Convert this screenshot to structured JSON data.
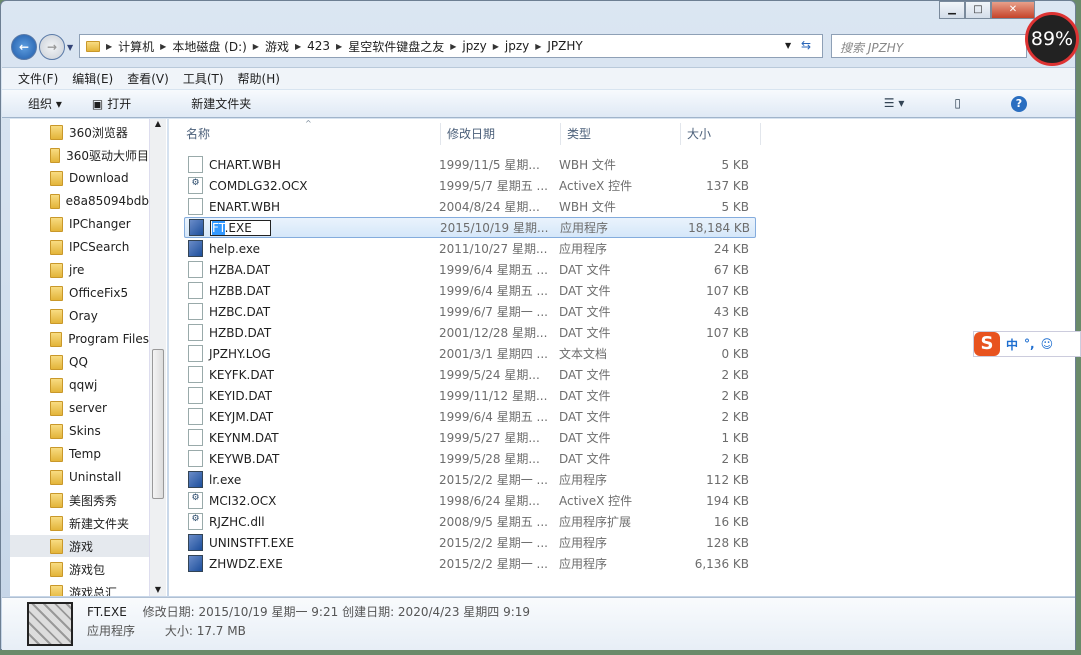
{
  "window": {
    "gauge": "89%",
    "controls": [
      "minimize",
      "maximize",
      "close"
    ]
  },
  "address": {
    "crumbs": [
      "计算机",
      "本地磁盘 (D:)",
      "游戏",
      "423",
      "星空软件键盘之友",
      "jpzy",
      "jpzy",
      "JPZHY"
    ],
    "search_placeholder": "搜索 JPZHY"
  },
  "menu": [
    "文件(F)",
    "编辑(E)",
    "查看(V)",
    "工具(T)",
    "帮助(H)"
  ],
  "toolbar": {
    "organize": "组织 ▾",
    "open": "打开",
    "new_folder": "新建文件夹"
  },
  "sidebar": {
    "items": [
      "360浏览器",
      "360驱动大师目",
      "Download",
      "e8a85094bdb",
      "IPChanger",
      "IPCSearch",
      "jre",
      "OfficeFix5",
      "Oray",
      "Program Files",
      "QQ",
      "qqwj",
      "server",
      "Skins",
      "Temp",
      "Uninstall",
      "美图秀秀",
      "新建文件夹",
      "游戏",
      "游戏包",
      "游戏总汇"
    ],
    "selected": "游戏"
  },
  "columns": [
    "名称",
    "修改日期",
    "类型",
    "大小"
  ],
  "files": [
    {
      "name": "CHART.WBH",
      "date": "1999/11/5 星期...",
      "type": "WBH 文件",
      "size": "5 KB",
      "icon": "file"
    },
    {
      "name": "COMDLG32.OCX",
      "date": "1999/5/7 星期五 ...",
      "type": "ActiveX 控件",
      "size": "137 KB",
      "icon": "ocx"
    },
    {
      "name": "ENART.WBH",
      "date": "2004/8/24 星期...",
      "type": "WBH 文件",
      "size": "5 KB",
      "icon": "file"
    },
    {
      "name": "FT.EXE",
      "name_sel": "FT",
      "name_rest": ".EXE",
      "date": "2015/10/19 星期...",
      "type": "应用程序",
      "size": "18,184 KB",
      "icon": "exe"
    },
    {
      "name": "help.exe",
      "date": "2011/10/27 星期...",
      "type": "应用程序",
      "size": "24 KB",
      "icon": "exe"
    },
    {
      "name": "HZBA.DAT",
      "date": "1999/6/4 星期五 ...",
      "type": "DAT 文件",
      "size": "67 KB",
      "icon": "file"
    },
    {
      "name": "HZBB.DAT",
      "date": "1999/6/4 星期五 ...",
      "type": "DAT 文件",
      "size": "107 KB",
      "icon": "file"
    },
    {
      "name": "HZBC.DAT",
      "date": "1999/6/7 星期一 ...",
      "type": "DAT 文件",
      "size": "43 KB",
      "icon": "file"
    },
    {
      "name": "HZBD.DAT",
      "date": "2001/12/28 星期...",
      "type": "DAT 文件",
      "size": "107 KB",
      "icon": "file"
    },
    {
      "name": "JPZHY.LOG",
      "date": "2001/3/1 星期四 ...",
      "type": "文本文档",
      "size": "0 KB",
      "icon": "file"
    },
    {
      "name": "KEYFK.DAT",
      "date": "1999/5/24 星期...",
      "type": "DAT 文件",
      "size": "2 KB",
      "icon": "file"
    },
    {
      "name": "KEYID.DAT",
      "date": "1999/11/12 星期...",
      "type": "DAT 文件",
      "size": "2 KB",
      "icon": "file"
    },
    {
      "name": "KEYJM.DAT",
      "date": "1999/6/4 星期五 ...",
      "type": "DAT 文件",
      "size": "2 KB",
      "icon": "file"
    },
    {
      "name": "KEYNM.DAT",
      "date": "1999/5/27 星期...",
      "type": "DAT 文件",
      "size": "1 KB",
      "icon": "file"
    },
    {
      "name": "KEYWB.DAT",
      "date": "1999/5/28 星期...",
      "type": "DAT 文件",
      "size": "2 KB",
      "icon": "file"
    },
    {
      "name": "lr.exe",
      "date": "2015/2/2 星期一 ...",
      "type": "应用程序",
      "size": "112 KB",
      "icon": "exe"
    },
    {
      "name": "MCI32.OCX",
      "date": "1998/6/24 星期...",
      "type": "ActiveX 控件",
      "size": "194 KB",
      "icon": "ocx"
    },
    {
      "name": "RJZHC.dll",
      "date": "2008/9/5 星期五 ...",
      "type": "应用程序扩展",
      "size": "16 KB",
      "icon": "dll"
    },
    {
      "name": "UNINSTFT.EXE",
      "date": "2015/2/2 星期一 ...",
      "type": "应用程序",
      "size": "128 KB",
      "icon": "exe"
    },
    {
      "name": "ZHWDZ.EXE",
      "date": "2015/2/2 星期一 ...",
      "type": "应用程序",
      "size": "6,136 KB",
      "icon": "exe"
    }
  ],
  "details": {
    "name": "FT.EXE",
    "modified": "修改日期: 2015/10/19 星期一 9:21",
    "created": "创建日期: 2020/4/23 星期四 9:19",
    "type": "应用程序",
    "size": "大小: 17.7 MB"
  },
  "ime": {
    "lang": "中",
    "punct": "°,",
    "logo": "S"
  }
}
